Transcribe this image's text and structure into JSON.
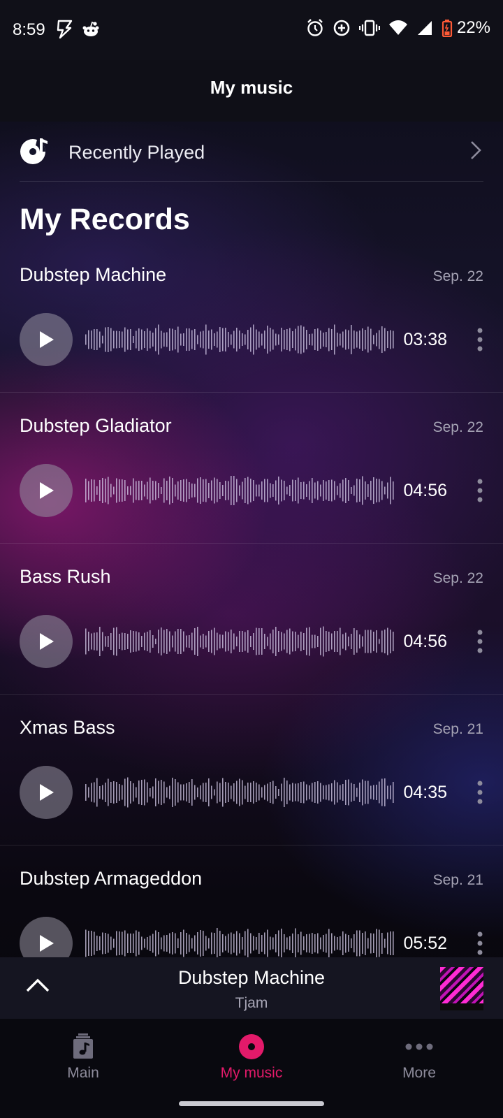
{
  "status_bar": {
    "time": "8:59",
    "battery": "22%",
    "icons": [
      "flash-icon",
      "reddit-icon",
      "alarm-icon",
      "data-saver-icon",
      "vibrate-icon",
      "wifi-icon",
      "signal-icon",
      "battery-icon"
    ]
  },
  "header": {
    "title": "My music"
  },
  "recently_played": {
    "label": "Recently Played",
    "icon": "music-note-disc-icon"
  },
  "section_title": "My Records",
  "records": [
    {
      "title": "Dubstep Machine",
      "date": "Sep. 22",
      "duration": "03:38"
    },
    {
      "title": "Dubstep Gladiator",
      "date": "Sep. 22",
      "duration": "04:56"
    },
    {
      "title": "Bass Rush",
      "date": "Sep. 22",
      "duration": "04:56"
    },
    {
      "title": "Xmas Bass",
      "date": "Sep. 21",
      "duration": "04:35"
    },
    {
      "title": "Dubstep Armageddon",
      "date": "Sep. 21",
      "duration": "05:52"
    }
  ],
  "mini_player": {
    "title": "Dubstep Machine",
    "artist": "Tjam"
  },
  "bottom_nav": {
    "items": [
      {
        "label": "Main",
        "icon": "music-folder-icon"
      },
      {
        "label": "My music",
        "icon": "record-disc-icon",
        "active": true
      },
      {
        "label": "More",
        "icon": "more-dots-icon"
      }
    ]
  },
  "colors": {
    "accent": "#e31a6a",
    "background": "#07060b"
  }
}
